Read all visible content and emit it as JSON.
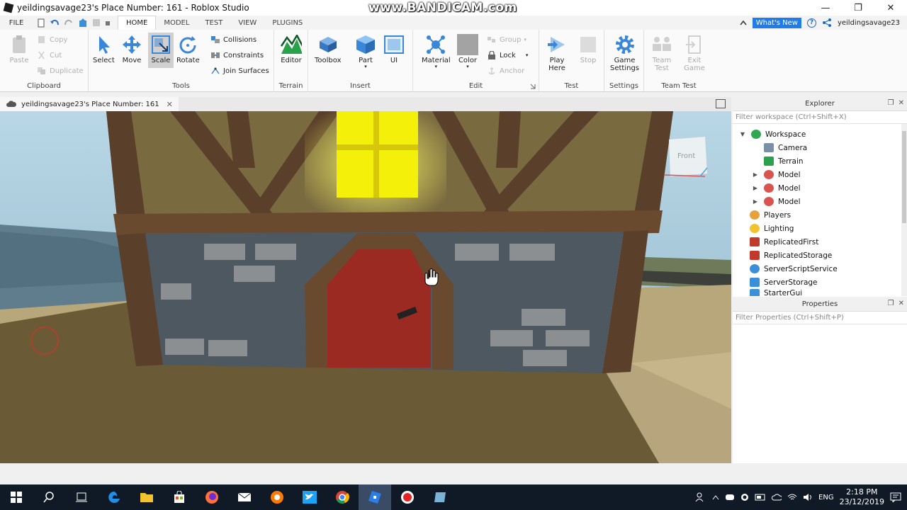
{
  "window": {
    "title": "yeildingsavage23's Place Number: 161 - Roblox Studio",
    "watermark": "www.BANDICAM.com",
    "minimize": "—",
    "maximize": "❐",
    "close": "✕"
  },
  "menu": {
    "file": "FILE",
    "tabs": [
      "HOME",
      "MODEL",
      "TEST",
      "VIEW",
      "PLUGINS"
    ],
    "whats_new": "What's New",
    "help": "?",
    "username": "yeildingsavage23"
  },
  "ribbon": {
    "clipboard": {
      "label": "Clipboard",
      "paste": "Paste",
      "copy": "Copy",
      "cut": "Cut",
      "duplicate": "Duplicate"
    },
    "tools": {
      "label": "Tools",
      "select": "Select",
      "move": "Move",
      "scale": "Scale",
      "rotate": "Rotate",
      "collisions": "Collisions",
      "constraints": "Constraints",
      "join_surfaces": "Join Surfaces"
    },
    "terrain": {
      "label": "Terrain",
      "editor": "Editor"
    },
    "insert": {
      "label": "Insert",
      "toolbox": "Toolbox",
      "part": "Part",
      "ui": "UI"
    },
    "edit": {
      "label": "Edit",
      "material": "Material",
      "color": "Color",
      "group": "Group",
      "lock": "Lock",
      "anchor": "Anchor"
    },
    "test": {
      "label": "Test",
      "play_here_1": "Play",
      "play_here_2": "Here",
      "stop": "Stop"
    },
    "settings": {
      "label": "Settings",
      "game_settings_1": "Game",
      "game_settings_2": "Settings"
    },
    "team_test": {
      "label": "Team Test",
      "team_test_1": "Team",
      "team_test_2": "Test",
      "exit_game_1": "Exit",
      "exit_game_2": "Game"
    }
  },
  "document_tab": {
    "label": "yeildingsavage23's Place Number: 161",
    "close": "✕"
  },
  "viewport": {
    "view_cube_label": "Front"
  },
  "explorer": {
    "title": "Explorer",
    "filter_placeholder": "Filter workspace (Ctrl+Shift+X)",
    "items": [
      {
        "label": "Workspace",
        "color": "#2fa84f"
      },
      {
        "label": "Camera",
        "color": "#7a8fa6"
      },
      {
        "label": "Terrain",
        "color": "#2aa14b"
      },
      {
        "label": "Model",
        "color": "#d9534f"
      },
      {
        "label": "Model",
        "color": "#d9534f"
      },
      {
        "label": "Model",
        "color": "#d9534f"
      },
      {
        "label": "Players",
        "color": "#e6a23c"
      },
      {
        "label": "Lighting",
        "color": "#f2c230"
      },
      {
        "label": "ReplicatedFirst",
        "color": "#c0392b"
      },
      {
        "label": "ReplicatedStorage",
        "color": "#c0392b"
      },
      {
        "label": "ServerScriptService",
        "color": "#3a8fd9"
      },
      {
        "label": "ServerStorage",
        "color": "#3a8fd9"
      },
      {
        "label": "StarterGui",
        "color": "#3a8fd9"
      }
    ]
  },
  "properties": {
    "title": "Properties",
    "filter_placeholder": "Filter Properties (Ctrl+Shift+P)"
  },
  "taskbar": {
    "time": "2:18 PM",
    "date": "23/12/2019",
    "language": "ENG"
  },
  "colors": {
    "accent": "#1f7ce8",
    "taskbar": "#101a27",
    "door": "#9b2a22",
    "window_glow": "#f4f00a"
  }
}
